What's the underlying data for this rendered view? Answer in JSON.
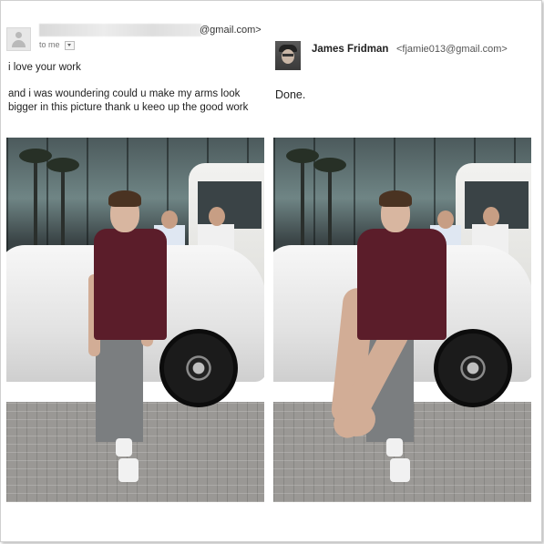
{
  "left_email": {
    "sender_domain": "@gmail.com>",
    "to_label": "to me",
    "greeting": "i love your work",
    "body": "and i was woundering could u make my arms look bigger in this picture thank u keeo up the good work"
  },
  "right_email": {
    "sender_name": "James Fridman",
    "sender_email": "<fjamie013@gmail.com>",
    "reply": "Done."
  },
  "colors": {
    "shirt": "#5b1d2a",
    "car": "#f1f1f1",
    "pavement": "#9a9895"
  },
  "icons": {
    "left_avatar": "person-placeholder-icon",
    "dropdown": "chevron-down-icon"
  }
}
